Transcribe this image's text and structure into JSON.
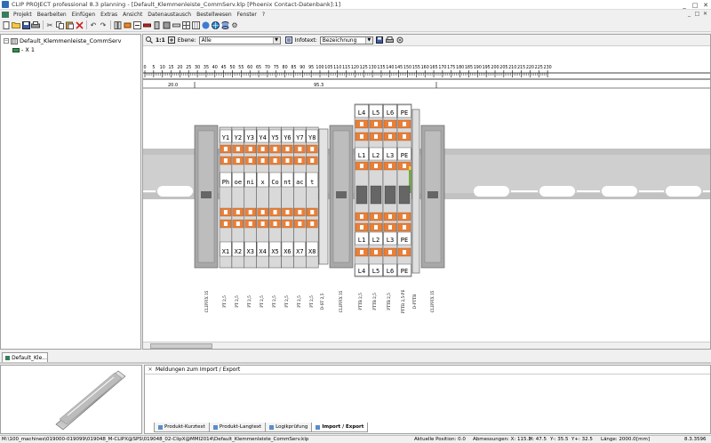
{
  "window": {
    "title": "CLIP PROJECT professional 8.3 planning - [Default_Klemmenleiste_CommServ.klp [Phoenix Contact-Datenbank]:1]",
    "controls": [
      "_",
      "□",
      "✕"
    ]
  },
  "menu": {
    "items": [
      "Projekt",
      "Bearbeiten",
      "Einfügen",
      "Extras",
      "Ansicht",
      "Datenaustausch",
      "Bestellwesen",
      "Fenster",
      "?"
    ]
  },
  "tree": {
    "root": "Default_Klemmenleiste_CommServ",
    "child": "- X 1"
  },
  "viewbar": {
    "scale": "1:1",
    "layer_label": "Ebene:",
    "layer_value": "Alle",
    "infotext_label": "Infotext:",
    "infotext_value": "Bezeichnung"
  },
  "ruler": {
    "ticks": [
      "0",
      "5",
      "10",
      "15",
      "20",
      "25",
      "30",
      "35",
      "40",
      "45",
      "50",
      "55",
      "60",
      "65",
      "70",
      "75",
      "80",
      "85",
      "90",
      "95",
      "100",
      "105",
      "110",
      "115",
      "120",
      "125",
      "130",
      "135",
      "140",
      "145",
      "150",
      "155",
      "160",
      "165",
      "170",
      "175",
      "180",
      "185",
      "190",
      "195",
      "200",
      "205",
      "210",
      "215",
      "220",
      "225",
      "230"
    ],
    "dim1": "20.0",
    "dim2": "95.3"
  },
  "terminals": {
    "group1_top": [
      "Y1",
      "Y2",
      "Y3",
      "Y4",
      "Y5",
      "Y6",
      "Y7",
      "Y8"
    ],
    "group1_mid": [
      "Ph",
      "oe",
      "ni",
      "x",
      "Co",
      "nt",
      "ac",
      "t"
    ],
    "group1_bot": [
      "X1",
      "X2",
      "X3",
      "X4",
      "X5",
      "X6",
      "X7",
      "X8"
    ],
    "group2_r1": [
      "L4",
      "L5",
      "L6",
      "PE"
    ],
    "group2_r2": [
      "L1",
      "L2",
      "L3",
      "PE"
    ],
    "group2_r3": [
      "L1",
      "L2",
      "L3",
      "PE"
    ],
    "group2_r4": [
      "L4",
      "L5",
      "L6",
      "PE"
    ],
    "vlabels": [
      "CLIPFIX 35",
      "PT 2,5",
      "PT 2,5",
      "PT 2,5",
      "PT 2,5",
      "PT 2,5",
      "PT 2,5",
      "PT 2,5",
      "PT 2,5",
      "D-ST 2,5",
      "CLIPFIX 35",
      "PTTB 2,5",
      "PTTB 2,5",
      "PTTB 2,5",
      "PTTB 2,5-PE",
      "D-PTTB",
      "CLIPFIX 35"
    ]
  },
  "doctab": {
    "label": "Default_Kle..."
  },
  "messages": {
    "title": "Meldungen zum Import / Export",
    "close": "✕",
    "tabs": [
      "Produkt-Kurztext",
      "Produkt-Langtext",
      "Logikprüfung",
      "Import / Export"
    ]
  },
  "status": {
    "path": "M:\\100_machines\\019000-019099\\019048_M-CLIPX@SPS\\019048_02-ClipX@MMI2014\\Default_Klemmenleiste_CommServ.klp",
    "position": "Aktuelle Position: 0.0",
    "dimensions": "Abmessungen: X: 115.3",
    "h": "H: 47.5",
    "yminus": "Y-: 35.5",
    "yplus": "Y+: 32.5",
    "length": "Länge: 2000.0",
    "unit": "[mm]",
    "version": "8.3.3596"
  }
}
